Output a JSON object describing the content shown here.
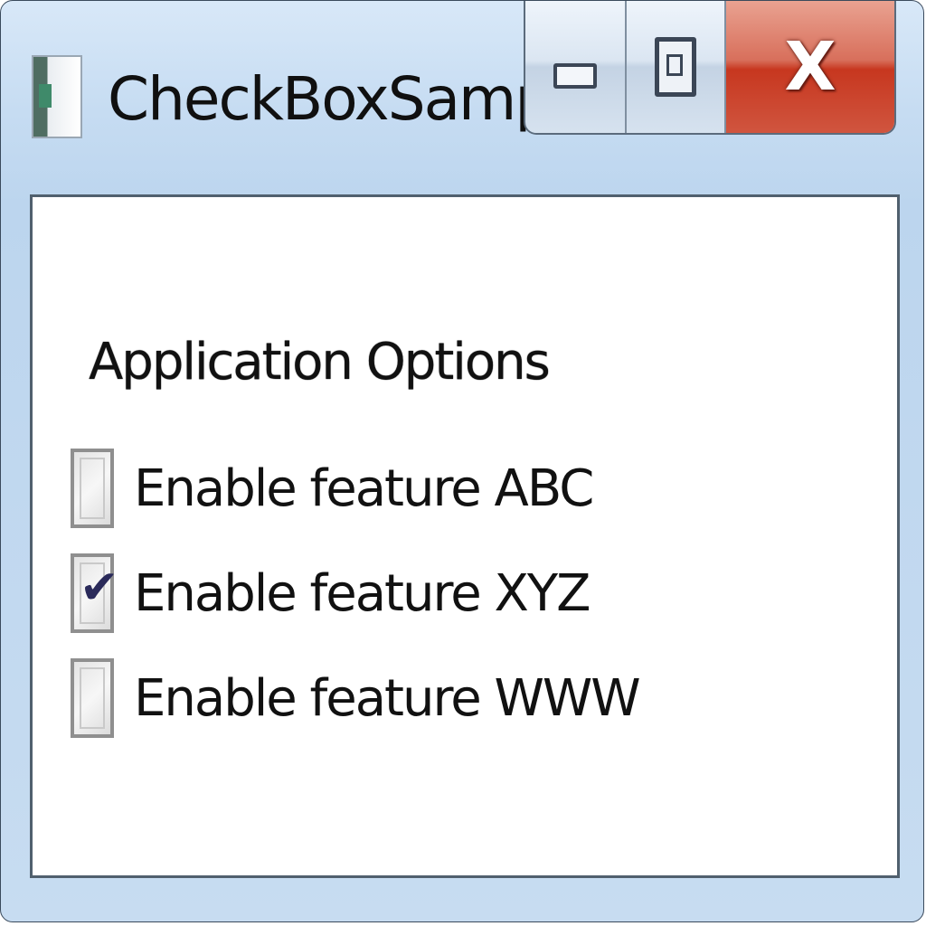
{
  "window": {
    "title": "CheckBoxSample",
    "close_glyph": "X"
  },
  "icons": {
    "app": "app-window-icon",
    "minimize": "minimize-icon",
    "maximize": "maximize-icon",
    "close": "close-icon",
    "check": "checkmark-icon"
  },
  "options": {
    "title": "Application Options",
    "items": [
      {
        "label": "Enable feature ABC",
        "checked": false
      },
      {
        "label": "Enable feature XYZ",
        "checked": true
      },
      {
        "label": "Enable feature WWW",
        "checked": false
      }
    ]
  },
  "colors": {
    "titlebar": "#c6dcf2",
    "close_button": "#c7371f",
    "border": "#3a4a5c"
  }
}
